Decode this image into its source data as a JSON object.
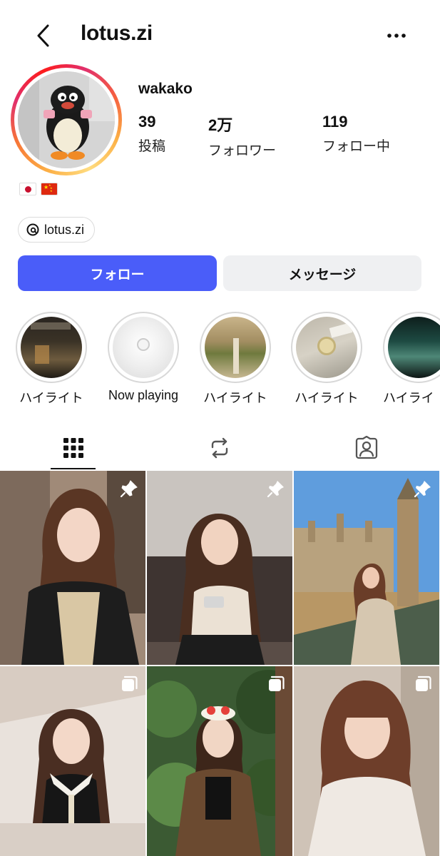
{
  "header": {
    "username": "lotus.zi"
  },
  "profile": {
    "display_name": "wakako",
    "stats": [
      {
        "value": "39",
        "label": "投稿"
      },
      {
        "value": "2万",
        "label": "フォロワー"
      },
      {
        "value": "119",
        "label": "フォロー中"
      }
    ],
    "flags": [
      "japan-flag",
      "china-flag"
    ],
    "threads_handle": "lotus.zi"
  },
  "actions": {
    "follow_label": "フォロー",
    "message_label": "メッセージ",
    "follow_color": "#4a5df9"
  },
  "highlights": [
    {
      "label": "ハイライト"
    },
    {
      "label": "Now playing"
    },
    {
      "label": "ハイライト"
    },
    {
      "label": "ハイライト"
    },
    {
      "label": "ハイライ"
    }
  ],
  "tabs": [
    {
      "icon": "grid-icon",
      "active": true
    },
    {
      "icon": "reels-repost-icon",
      "active": false
    },
    {
      "icon": "tagged-icon",
      "active": false
    }
  ],
  "posts": [
    {
      "badge": "pin-icon"
    },
    {
      "badge": "pin-icon"
    },
    {
      "badge": "pin-icon"
    },
    {
      "badge": "carousel-icon"
    },
    {
      "badge": "carousel-icon"
    },
    {
      "badge": "carousel-icon"
    }
  ]
}
